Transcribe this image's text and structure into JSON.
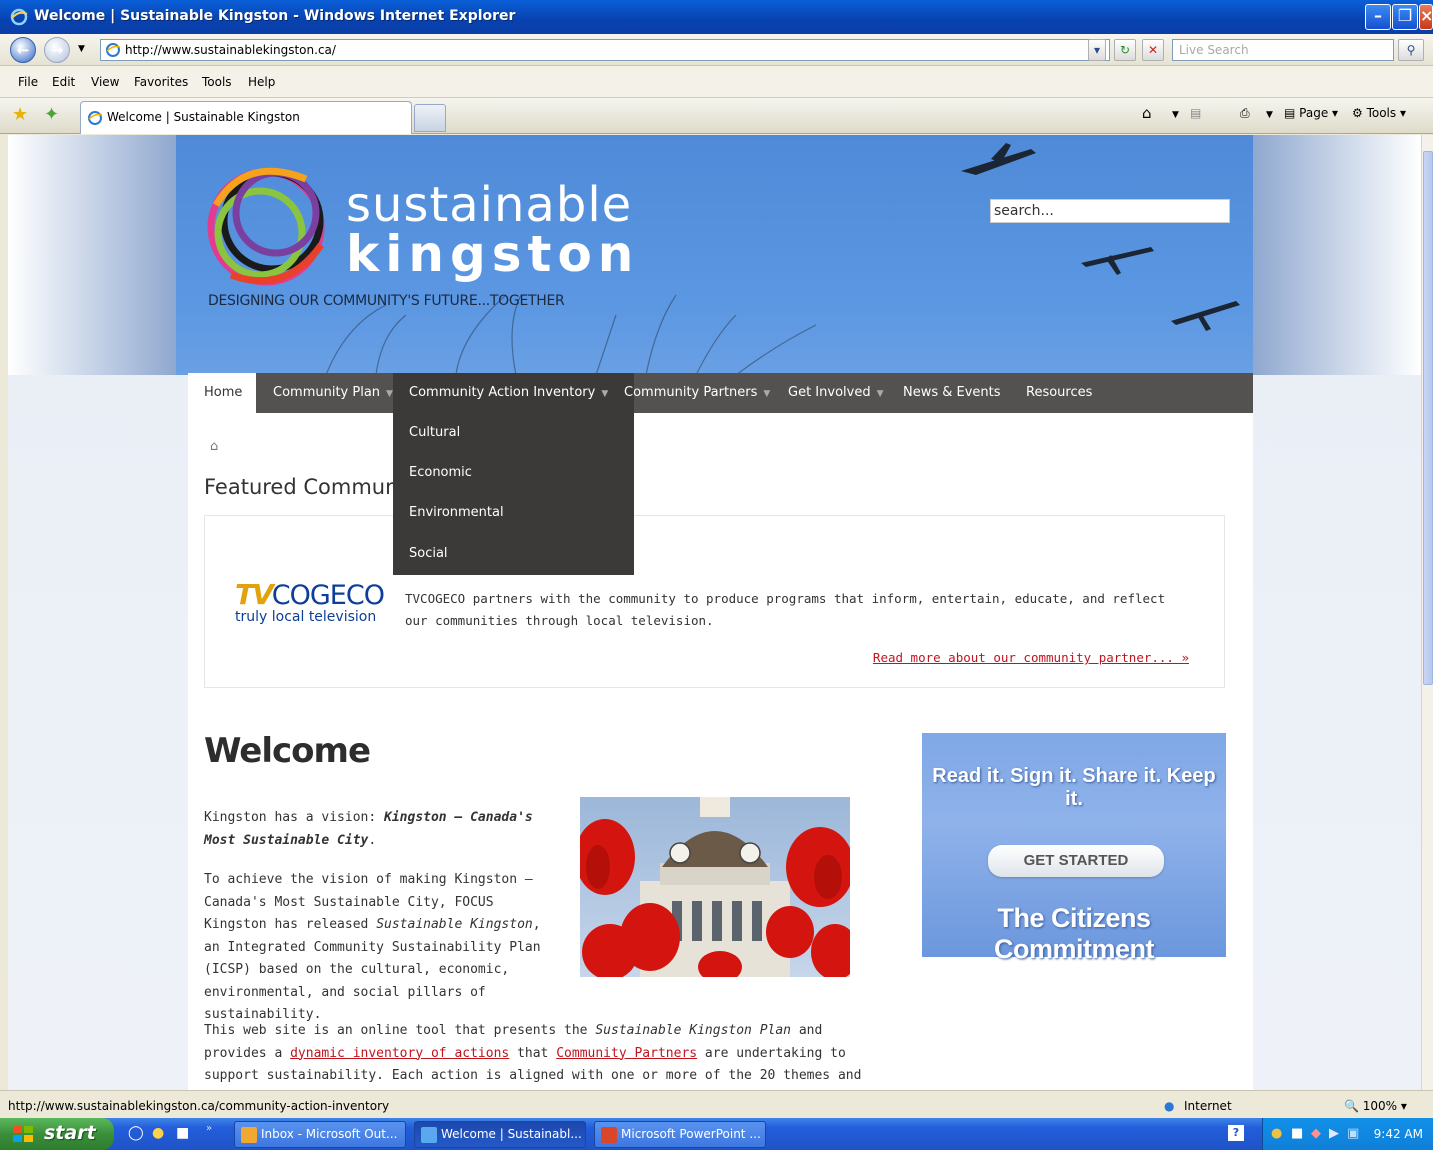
{
  "window": {
    "title": "Welcome | Sustainable Kingston - Windows Internet Explorer"
  },
  "address": {
    "url": "http://www.sustainablekingston.ca/",
    "live_search_placeholder": "Live Search"
  },
  "menu": [
    "File",
    "Edit",
    "View",
    "Favorites",
    "Tools",
    "Help"
  ],
  "tabs": {
    "active_label": "Welcome | Sustainable Kingston"
  },
  "command_bar": {
    "page_label": "Page",
    "tools_label": "Tools"
  },
  "site": {
    "logo_line1": "sustainable",
    "logo_line2": "kingston",
    "tagline": "DESIGNING OUR COMMUNITY'S FUTURE...TOGETHER",
    "search_value": "search..."
  },
  "nav": {
    "items": [
      {
        "label": "Home"
      },
      {
        "label": "Community Plan"
      },
      {
        "label": "Community Action Inventory"
      },
      {
        "label": "Community Partners"
      },
      {
        "label": "Get Involved"
      },
      {
        "label": "News & Events"
      },
      {
        "label": "Resources"
      }
    ],
    "dropdown": [
      "Cultural",
      "Economic",
      "Environmental",
      "Social"
    ]
  },
  "featured": {
    "title": "Featured Community Partner",
    "logo_tv": "TV",
    "logo_cogeco": "COGECO",
    "logo_sub": "truly local television",
    "text": "TVCOGECO partners with the community to produce programs that inform, entertain, educate, and reflect our communities through local television.",
    "link": "Read more about our community partner... »"
  },
  "welcome": {
    "heading": "Welcome",
    "p1_a": "Kingston has a vision: ",
    "p1_b": "Kingston — Canada's Most Sustainable City",
    "p1_c": ".",
    "p2_a": "To achieve the vision of making Kingston — Canada's Most Sustainable City, FOCUS Kingston has released ",
    "p2_b": "Sustainable Kingston",
    "p2_c": ", an Integrated Community Sustainability Plan (ICSP) based on the cultural, economic, environmental, and social pillars of sustainability.",
    "p3_a": "This web site is an online tool that presents the ",
    "p3_b": "Sustainable Kingston Plan",
    "p3_c": " and provides a ",
    "p3_link1": "dynamic inventory of actions",
    "p3_d": " that ",
    "p3_link2": "Community Partners",
    "p3_e": " are undertaking to support sustainability. Each action is aligned with one or more of the 20 themes and each theme with one of the four pillars of"
  },
  "commitment": {
    "line1": "Read it. Sign it. Share it. Keep it.",
    "button": "GET STARTED",
    "line2": "The Citizens Commitment"
  },
  "status": {
    "url": "http://www.sustainablekingston.ca/community-action-inventory",
    "zone": "Internet",
    "zoom": "100%"
  },
  "taskbar": {
    "start": "start",
    "tasks": [
      {
        "label": "Inbox - Microsoft Out..."
      },
      {
        "label": "Welcome | Sustainabl..."
      },
      {
        "label": "Microsoft PowerPoint ..."
      }
    ],
    "clock": "9:42 AM"
  },
  "colors": {
    "header_blue": "#5b97e2",
    "nav_bg": "#545250",
    "dropdown_bg": "#3b3a38",
    "link_red": "#c0151d",
    "commitment_blue": "#7fa8e6"
  }
}
